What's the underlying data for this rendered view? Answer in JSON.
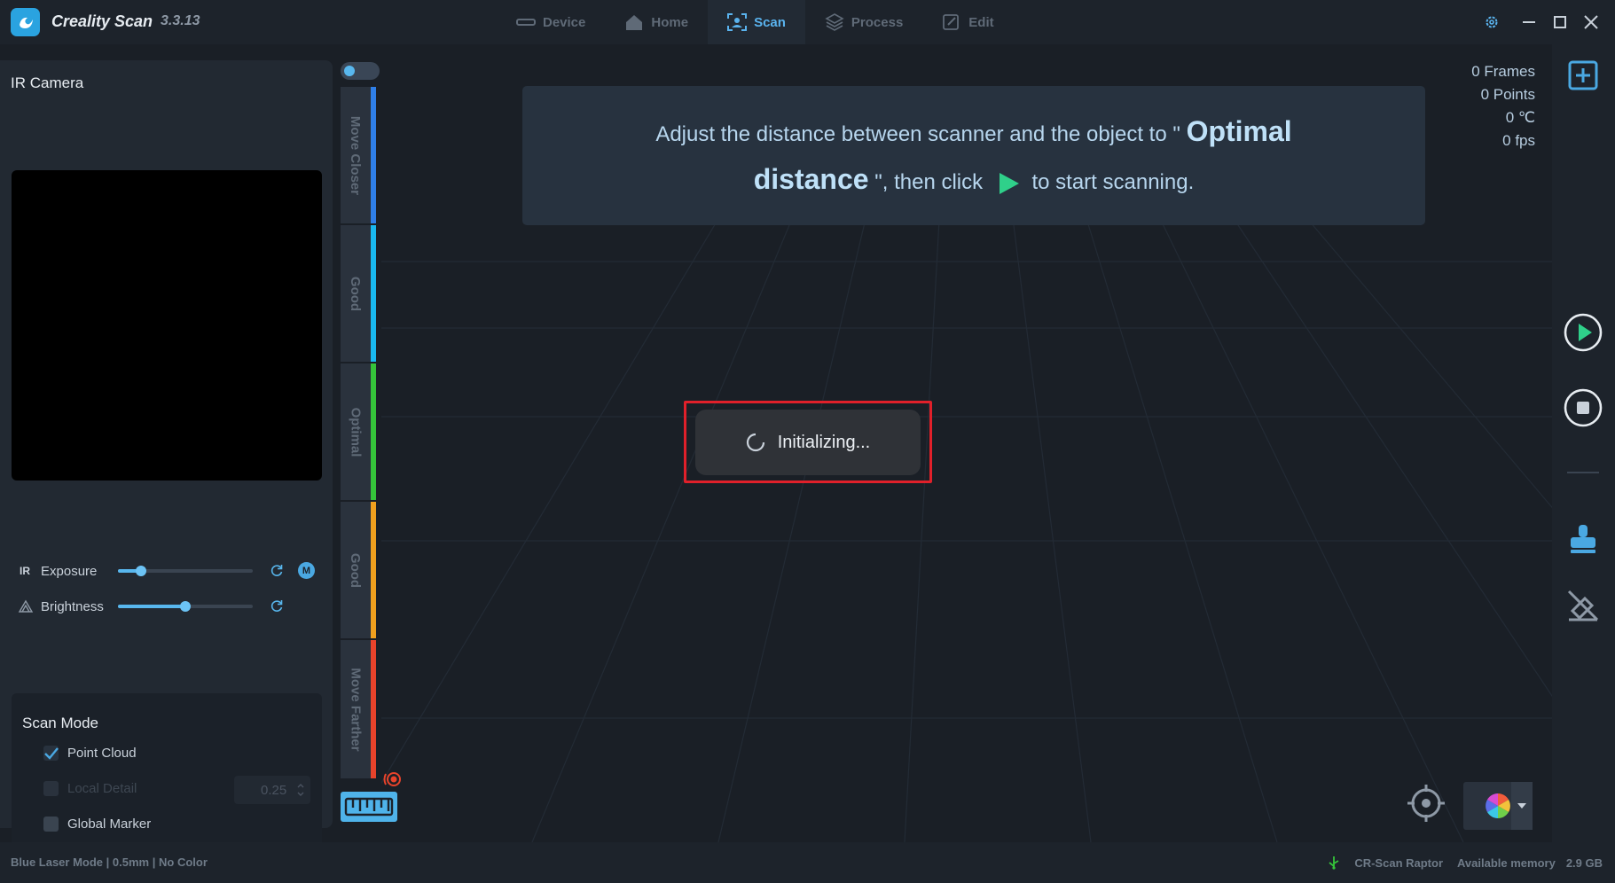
{
  "app": {
    "name": "Creality Scan",
    "version": "3.3.13"
  },
  "tabs": [
    {
      "label": "Device",
      "icon": "device-icon",
      "active": false
    },
    {
      "label": "Home",
      "icon": "home-icon",
      "active": false
    },
    {
      "label": "Scan",
      "icon": "scan-icon",
      "active": true
    },
    {
      "label": "Process",
      "icon": "process-icon",
      "active": false
    },
    {
      "label": "Edit",
      "icon": "edit-icon",
      "active": false
    }
  ],
  "left_panel": {
    "title": "IR Camera",
    "exposure": {
      "prefix": "IR",
      "label": "Exposure",
      "value": 0.17,
      "mode_badge": "M"
    },
    "brightness": {
      "label": "Brightness",
      "value": 0.5
    },
    "scan_mode": {
      "title": "Scan Mode",
      "point_cloud": {
        "label": "Point Cloud",
        "checked": true
      },
      "local_detail": {
        "label": "Local Detail",
        "checked": false,
        "disabled": true,
        "value": "0.25"
      },
      "global_marker": {
        "label": "Global Marker",
        "checked": false
      }
    }
  },
  "distance_bar": {
    "segments": [
      {
        "label": "Move Closer",
        "color": "#2f7fe8"
      },
      {
        "label": "Good",
        "color": "#19b8ef"
      },
      {
        "label": "Optimal",
        "color": "#35c43a"
      },
      {
        "label": "Good",
        "color": "#f0a01e"
      },
      {
        "label": "Move Farther",
        "color": "#e8432b"
      }
    ]
  },
  "banner": {
    "part1": "Adjust the distance between scanner and the object to \"",
    "emphasis1": "Optimal",
    "emphasis2": "distance",
    "part2": "\", then click",
    "part3": "to start scanning."
  },
  "stats": {
    "frames": "0 Frames",
    "points": "0 Points",
    "temperature": "0 ℃",
    "fps": "0 fps"
  },
  "initializing": {
    "label": "Initializing..."
  },
  "status_bar": {
    "mode": "Blue Laser Mode",
    "resolution": "0.5mm",
    "color": "No Color",
    "separator": "|",
    "device": "CR-Scan Raptor",
    "memory_label": "Available memory",
    "memory_value": "2.9 GB"
  },
  "colors": {
    "accent": "#5ab3ee",
    "highlight": "#e0202a",
    "play": "#2fd08a"
  }
}
